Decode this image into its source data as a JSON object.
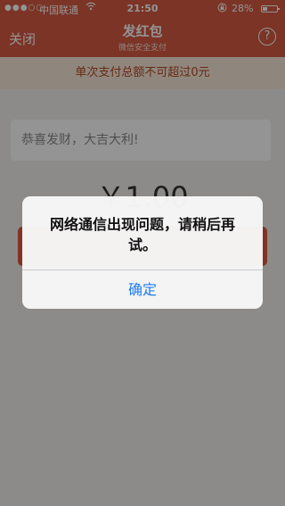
{
  "status_bar": {
    "signal": "●●●○○",
    "carrier": "中国联通",
    "time": "21:50",
    "battery": "28%",
    "wifi_icon": "wifi-icon",
    "lock_icon": "rotation-lock-icon"
  },
  "nav": {
    "close_label": "关闭",
    "title": "发红包",
    "subtitle": "微信安全支付",
    "help_label": "?"
  },
  "notice": "单次支付总额不可超过0元",
  "greeting_placeholder": "恭喜发财，大吉大利!",
  "amount": "￥1.00",
  "alert": {
    "message": "网络通信出现问题，请稍后再试。",
    "confirm_label": "确定"
  },
  "colors": {
    "brand": "#d55a43",
    "link_blue": "#1f7cf0",
    "notice_text": "#b5481f"
  }
}
